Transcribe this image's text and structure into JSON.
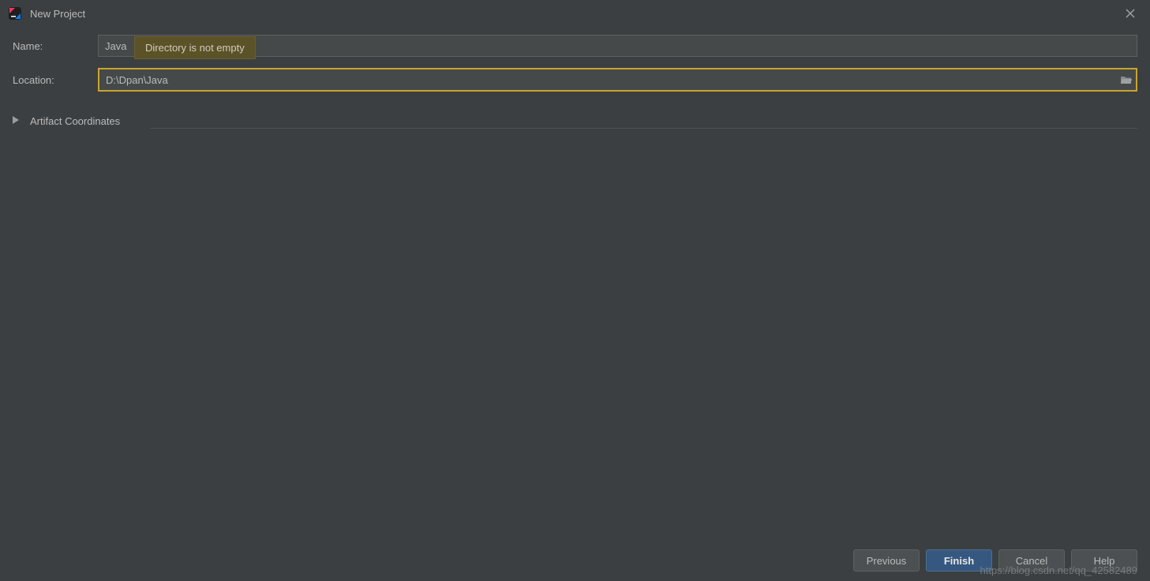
{
  "window": {
    "title": "New Project"
  },
  "form": {
    "name_label": "Name:",
    "name_value": "Java",
    "location_label": "Location:",
    "location_value": "D:\\Dpan\\Java",
    "tooltip": "Directory is not empty",
    "artifact_label": "Artifact Coordinates"
  },
  "buttons": {
    "previous": "Previous",
    "finish": "Finish",
    "cancel": "Cancel",
    "help": "Help"
  },
  "watermark": "https://blog.csdn.net/qq_42582489"
}
